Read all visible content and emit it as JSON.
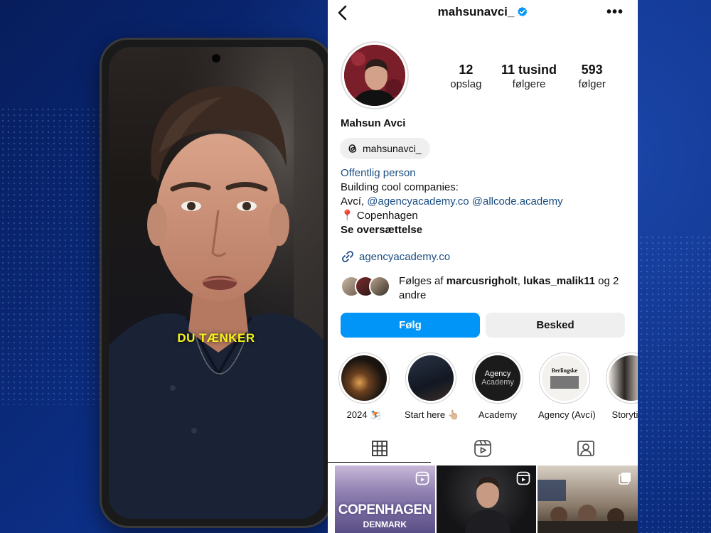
{
  "video": {
    "caption": "DU TÆNKER"
  },
  "profile": {
    "username": "mahsunavci_",
    "more_label": "•••",
    "stats": [
      {
        "value": "12",
        "label": "opslag"
      },
      {
        "value": "11 tusind",
        "label": "følgere"
      },
      {
        "value": "593",
        "label": "følger"
      }
    ],
    "name": "Mahsun Avci",
    "threads_handle": "mahsunavci_",
    "category": "Offentlig person",
    "bio_line1": "Building cool companies:",
    "bio_line2_prefix": "Avcí,",
    "bio_mention1": "@agencyacademy.co",
    "bio_mention2": "@allcode.academy",
    "location_pin": "📍",
    "location": "Copenhagen",
    "translate": "Se oversættelse",
    "link": "agencyacademy.co",
    "followed_prefix": "Følges af",
    "followed_user1": "marcusrigholt",
    "followed_sep": ",",
    "followed_user2": "lukas_malik11",
    "followed_suffix": "og 2 andre",
    "follow_button": "Følg",
    "message_button": "Besked"
  },
  "highlights": [
    {
      "label": "2024 ⛷️"
    },
    {
      "label": "Start here 👆🏼"
    },
    {
      "label": "Academy",
      "text1": "Agency",
      "text2": "Academy"
    },
    {
      "label": "Agency (Avcí)",
      "text": "Berlingske"
    },
    {
      "label": "Storytime"
    }
  ],
  "grid": [
    {
      "text1": "COPENHAGEN",
      "text2": "DENMARK"
    },
    {},
    {}
  ],
  "colors": {
    "accent": "#0095f6",
    "link": "#1c4e82",
    "caption": "#f3f51a",
    "verified": "#0095f6"
  }
}
